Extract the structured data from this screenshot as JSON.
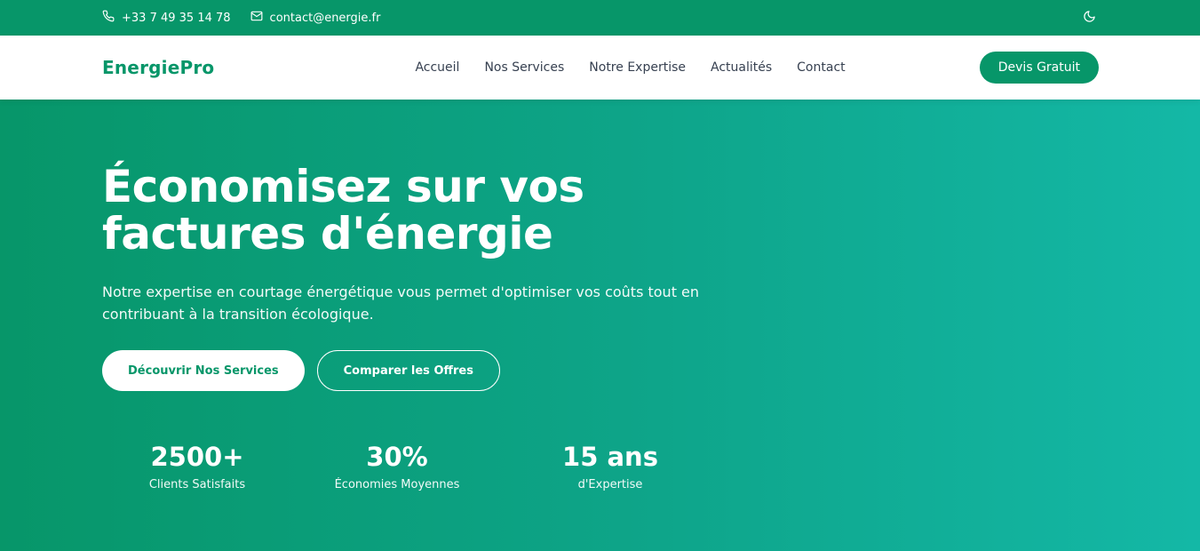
{
  "topbar": {
    "phone": "+33 7 49 35 14 78",
    "email": "contact@energie.fr"
  },
  "nav": {
    "logo": "EnergiePro",
    "links": [
      "Accueil",
      "Nos Services",
      "Notre Expertise",
      "Actualités",
      "Contact"
    ],
    "cta": "Devis Gratuit"
  },
  "hero": {
    "title_line1": "Économisez sur vos",
    "title_line2": "factures d'énergie",
    "lead": "Notre expertise en courtage énergétique vous permet d'optimiser vos coûts tout en contribuant à la transition écologique.",
    "primary_button": "Découvrir Nos Services",
    "secondary_button": "Comparer les Offres",
    "stats": [
      {
        "value": "2500+",
        "label": "Clients Satisfaits"
      },
      {
        "value": "30%",
        "label": "Économies Moyennes"
      },
      {
        "value": "15 ans",
        "label": "d'Expertise"
      }
    ]
  },
  "colors": {
    "brand": "#079669",
    "gradient_end": "#14b8a6"
  },
  "icons": [
    "phone-icon",
    "mail-icon",
    "moon-icon"
  ]
}
